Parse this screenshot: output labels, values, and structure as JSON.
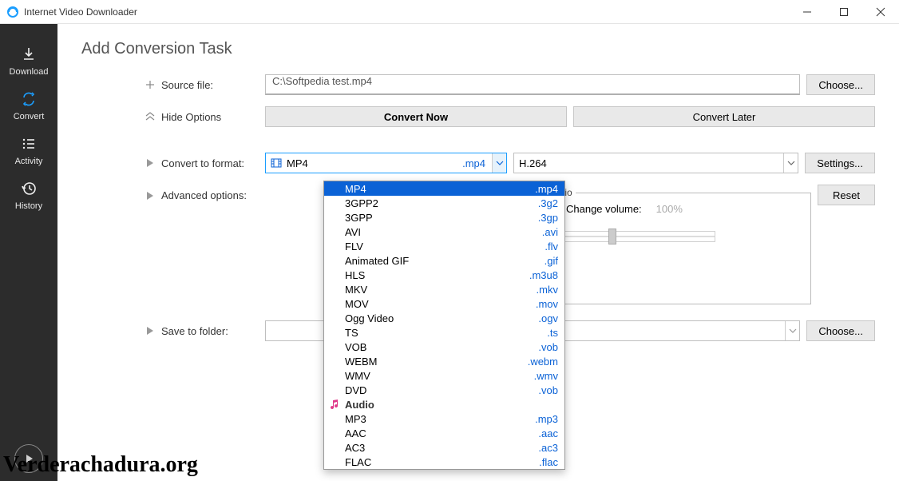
{
  "titlebar": {
    "title": "Internet Video Downloader"
  },
  "sidebar": {
    "items": [
      {
        "label": "Download"
      },
      {
        "label": "Convert"
      },
      {
        "label": "Activity"
      },
      {
        "label": "History"
      }
    ]
  },
  "page": {
    "title": "Add Conversion Task",
    "source_label": "Source file:",
    "source_value": "C:\\Softpedia test.mp4",
    "choose_label": "Choose...",
    "hide_options_label": "Hide Options",
    "convert_now_label": "Convert Now",
    "convert_later_label": "Convert Later",
    "convert_to_label": "Convert to format:",
    "advanced_label": "Advanced options:",
    "save_to_label": "Save to folder:",
    "settings_label": "Settings...",
    "reset_label": "Reset"
  },
  "format_combo": {
    "name": "MP4",
    "ext": ".mp4"
  },
  "codec_combo": {
    "value": "H.264"
  },
  "audio_group": {
    "legend": "Audio",
    "change_volume_label": "Change volume:",
    "volume_text": "100%"
  },
  "format_dropdown": {
    "items": [
      {
        "name": "MP4",
        "ext": ".mp4",
        "selected": true
      },
      {
        "name": "3GPP2",
        "ext": ".3g2"
      },
      {
        "name": "3GPP",
        "ext": ".3gp"
      },
      {
        "name": "AVI",
        "ext": ".avi"
      },
      {
        "name": "FLV",
        "ext": ".flv"
      },
      {
        "name": "Animated GIF",
        "ext": ".gif"
      },
      {
        "name": "HLS",
        "ext": ".m3u8"
      },
      {
        "name": "MKV",
        "ext": ".mkv"
      },
      {
        "name": "MOV",
        "ext": ".mov"
      },
      {
        "name": "Ogg Video",
        "ext": ".ogv"
      },
      {
        "name": "TS",
        "ext": ".ts"
      },
      {
        "name": "VOB",
        "ext": ".vob"
      },
      {
        "name": "WEBM",
        "ext": ".webm"
      },
      {
        "name": "WMV",
        "ext": ".wmv"
      },
      {
        "name": "DVD",
        "ext": ".vob"
      },
      {
        "name": "Audio",
        "header": true
      },
      {
        "name": "MP3",
        "ext": ".mp3"
      },
      {
        "name": "AAC",
        "ext": ".aac"
      },
      {
        "name": "AC3",
        "ext": ".ac3"
      },
      {
        "name": "FLAC",
        "ext": ".flac"
      }
    ]
  },
  "watermark": "Verderachadura.org"
}
